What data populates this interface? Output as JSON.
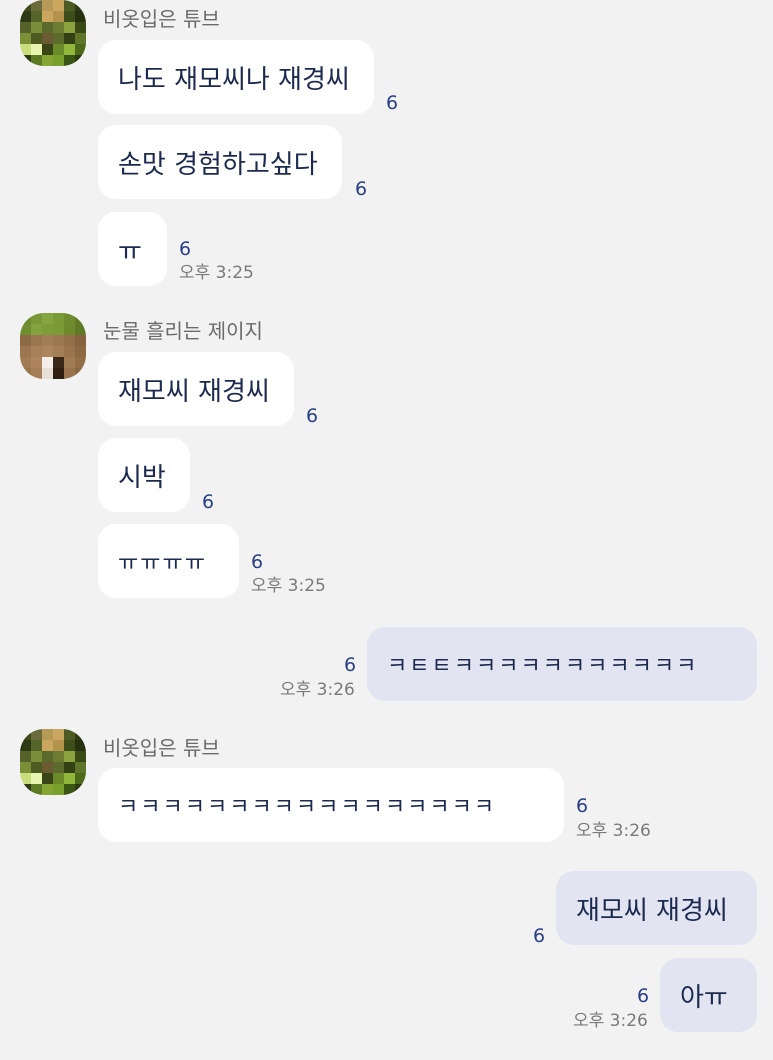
{
  "groups": [
    {
      "sender": "비옷입은 튜브",
      "messages": [
        {
          "text": "나도 재모씨나 재경씨",
          "unread": "6"
        },
        {
          "text": "손맛 경험하고싶다",
          "unread": "6"
        },
        {
          "text": "ㅠ",
          "unread": "6",
          "time": "오후 3:25"
        }
      ]
    },
    {
      "sender": "눈물 흘리는 제이지",
      "messages": [
        {
          "text": "재모씨 재경씨",
          "unread": "6"
        },
        {
          "text": "시박",
          "unread": "6"
        },
        {
          "text": "ㅠㅠㅠㅠ",
          "unread": "6",
          "time": "오후 3:25"
        }
      ]
    },
    {
      "sender": "me",
      "messages": [
        {
          "text": "ㅋㅌㅌㅋㅋㅋㅋㅋㅋㅋㅋㅋㅋㅋ",
          "unread": "6",
          "time": "오후 3:26"
        }
      ]
    },
    {
      "sender": "비옷입은 튜브",
      "messages": [
        {
          "text": "ㅋㅋㅋㅋㅋㅋㅋㅋㅋㅋㅋㅋㅋㅋㅋㅋㅋ",
          "unread": "6",
          "time": "오후 3:26"
        }
      ]
    },
    {
      "sender": "me",
      "messages": [
        {
          "text": "재모씨 재경씨",
          "unread": "6"
        },
        {
          "text": "아ㅠ",
          "unread": "6",
          "time": "오후 3:26"
        }
      ]
    }
  ]
}
